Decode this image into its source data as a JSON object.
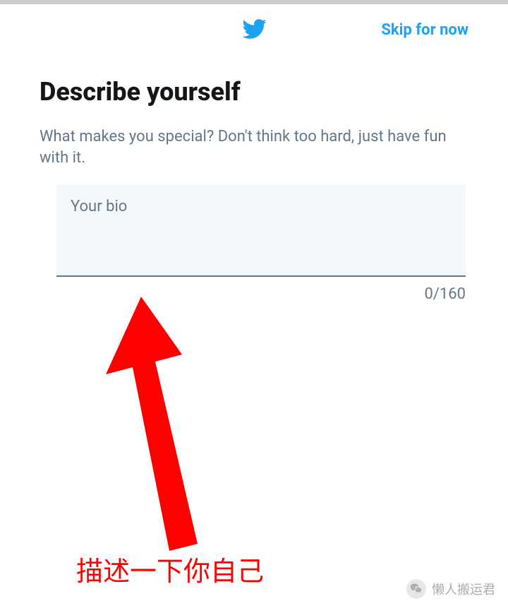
{
  "header": {
    "skip_label": "Skip for now"
  },
  "main": {
    "title": "Describe yourself",
    "subtitle": "What makes you special? Don't think too hard, just have fun with it.",
    "bio_placeholder": "Your bio",
    "char_count": "0/160"
  },
  "annotation": {
    "text": "描述一下你自己"
  },
  "watermark": {
    "text": "懒人搬运君"
  },
  "colors": {
    "twitter_blue": "#1DA1F2",
    "text_gray": "#657786",
    "annotation_red": "#ff0000"
  }
}
